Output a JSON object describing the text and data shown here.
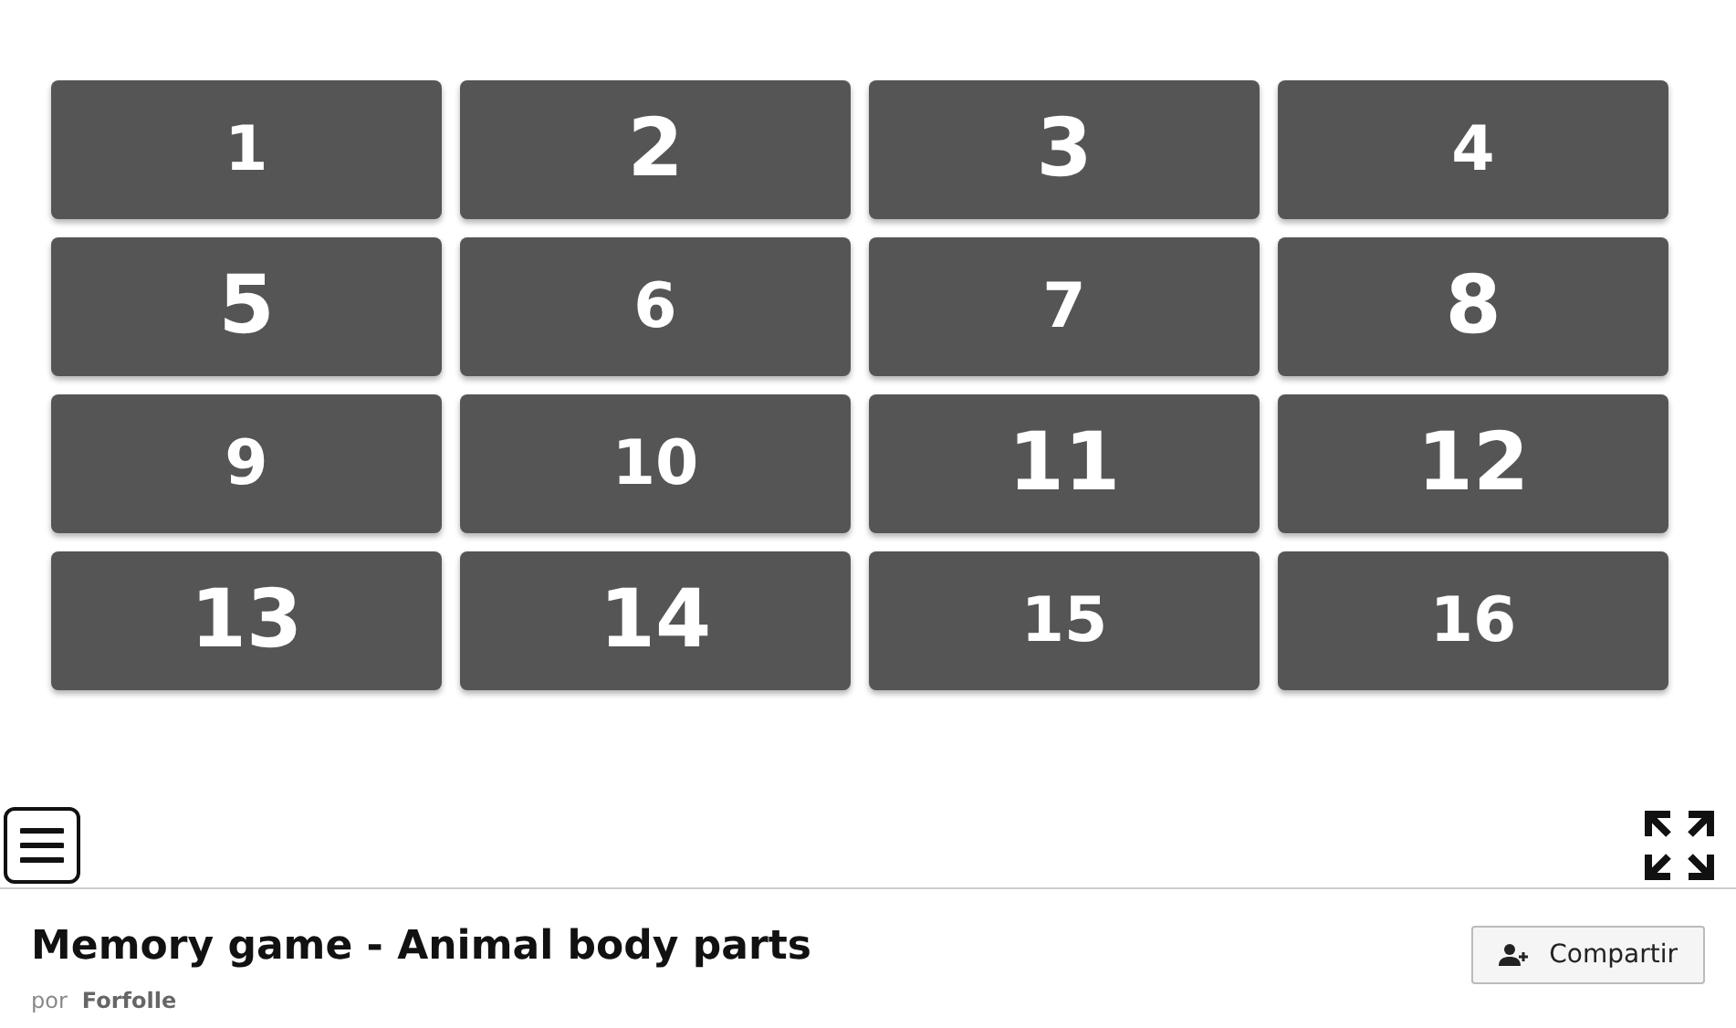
{
  "cards": [
    {
      "label": "1",
      "kind": "small"
    },
    {
      "label": "2",
      "kind": "large"
    },
    {
      "label": "3",
      "kind": "large"
    },
    {
      "label": "4",
      "kind": "small"
    },
    {
      "label": "5",
      "kind": "large"
    },
    {
      "label": "6",
      "kind": "small"
    },
    {
      "label": "7",
      "kind": "small"
    },
    {
      "label": "8",
      "kind": "large"
    },
    {
      "label": "9",
      "kind": "small"
    },
    {
      "label": "10",
      "kind": "small"
    },
    {
      "label": "11",
      "kind": "large"
    },
    {
      "label": "12",
      "kind": "large"
    },
    {
      "label": "13",
      "kind": "large"
    },
    {
      "label": "14",
      "kind": "large"
    },
    {
      "label": "15",
      "kind": "small"
    },
    {
      "label": "16",
      "kind": "small"
    }
  ],
  "activity": {
    "title": "Memory game - Animal body parts",
    "share_button": "Compartir",
    "byline_prefix": "por",
    "author": "Forfolle"
  }
}
